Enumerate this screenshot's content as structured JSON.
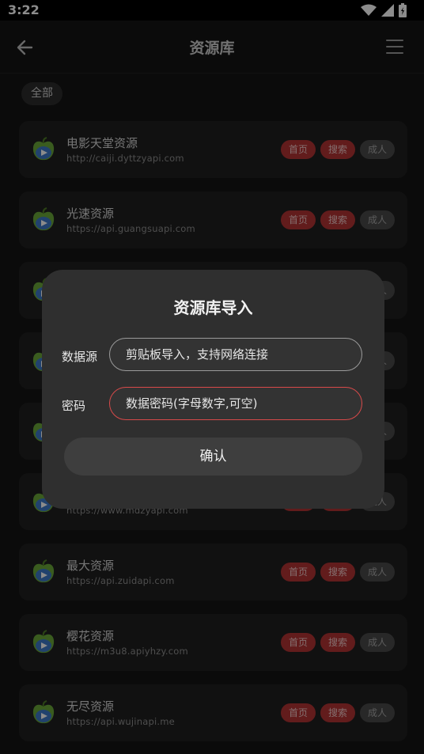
{
  "status_bar": {
    "time": "3:22"
  },
  "app_bar": {
    "title": "资源库"
  },
  "filter": {
    "chip_label": "全部"
  },
  "sources": [
    {
      "name": "电影天堂资源",
      "url": "http://caiji.dyttzyapi.com"
    },
    {
      "name": "光速资源",
      "url": "https://api.guangsuapi.com"
    },
    {
      "name": "",
      "url": ""
    },
    {
      "name": "",
      "url": ""
    },
    {
      "name": "",
      "url": ""
    },
    {
      "name": "",
      "url": "https://www.mdzyapi.com"
    },
    {
      "name": "最大资源",
      "url": "https://api.zuidapi.com"
    },
    {
      "name": "樱花资源",
      "url": "https://m3u8.apiyhzy.com"
    },
    {
      "name": "无尽资源",
      "url": "https://api.wujinapi.me"
    }
  ],
  "tags": {
    "home": "首页",
    "search": "搜索",
    "adult": "成人"
  },
  "dialog": {
    "title": "资源库导入",
    "source_label": "数据源",
    "source_placeholder": "剪贴板导入，支持网络连接",
    "password_label": "密码",
    "password_placeholder": "数据密码(字母数字,可空)",
    "confirm_label": "确认"
  },
  "colors": {
    "tag_red": "#b23333",
    "tag_gray": "#4a4a4a",
    "password_border": "#d84a4a"
  }
}
